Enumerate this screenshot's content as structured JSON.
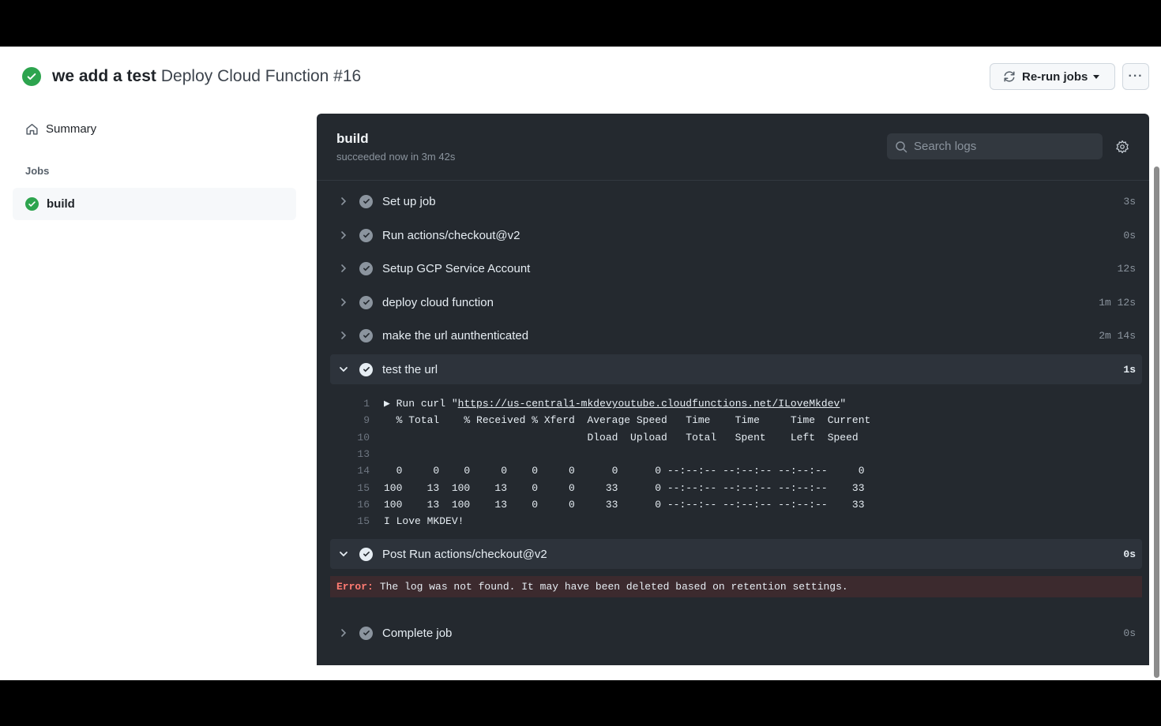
{
  "header": {
    "commit_title": "we add a test",
    "workflow_title": "Deploy Cloud Function #16",
    "rerun_label": "Re-run jobs",
    "more_label": "···"
  },
  "sidebar": {
    "summary_label": "Summary",
    "jobs_heading": "Jobs",
    "jobs": [
      {
        "label": "build"
      }
    ]
  },
  "log": {
    "job_title": "build",
    "status_text": "succeeded now in 3m 42s",
    "search_placeholder": "Search logs",
    "steps": [
      {
        "name": "Set up job",
        "duration": "3s"
      },
      {
        "name": "Run actions/checkout@v2",
        "duration": "0s"
      },
      {
        "name": "Setup GCP Service Account",
        "duration": "12s"
      },
      {
        "name": "deploy cloud function",
        "duration": "1m 12s"
      },
      {
        "name": "make the url aunthenticated",
        "duration": "2m 14s"
      },
      {
        "name": "test the url",
        "duration": "1s"
      },
      {
        "name": "Post Run actions/checkout@v2",
        "duration": "0s"
      },
      {
        "name": "Complete job",
        "duration": "0s"
      }
    ],
    "test_lines": [
      {
        "n": "1",
        "prefix": "▶ Run curl \"",
        "url": "https://us-central1-mkdevyoutube.cloudfunctions.net/ILoveMkdev",
        "suffix": "\""
      },
      {
        "n": "9",
        "text": "  % Total    % Received % Xferd  Average Speed   Time    Time     Time  Current"
      },
      {
        "n": "10",
        "text": "                                 Dload  Upload   Total   Spent    Left  Speed"
      },
      {
        "n": "13",
        "text": ""
      },
      {
        "n": "14",
        "text": "  0     0    0     0    0     0      0      0 --:--:-- --:--:-- --:--:--     0"
      },
      {
        "n": "15",
        "text": "100    13  100    13    0     0     33      0 --:--:-- --:--:-- --:--:--    33"
      },
      {
        "n": "16",
        "text": "100    13  100    13    0     0     33      0 --:--:-- --:--:-- --:--:--    33"
      },
      {
        "n": "15",
        "text": "I Love MKDEV!"
      }
    ],
    "error_label": "Error:",
    "error_text": "The log was not found. It may have been deleted based on retention settings."
  },
  "colors": {
    "success": "#2da44e",
    "log_bg": "#24292f",
    "error_bg": "#3c2a2e",
    "error_label": "#ff7b72"
  }
}
